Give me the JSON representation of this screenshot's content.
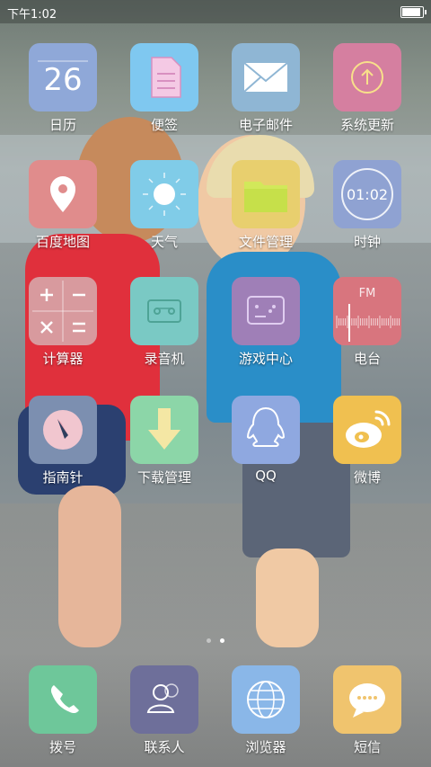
{
  "status_bar": {
    "time": "下午1:02",
    "battery_level": 0.9
  },
  "apps": {
    "calendar": {
      "label": "日历",
      "day": "26",
      "color": "#8fa8d8"
    },
    "notes": {
      "label": "便签",
      "color": "#7fc8f0"
    },
    "email": {
      "label": "电子邮件",
      "color": "#8fb6d4"
    },
    "update": {
      "label": "系统更新",
      "color": "#d57fa0"
    },
    "map": {
      "label": "百度地图",
      "color": "#e08c8c"
    },
    "weather": {
      "label": "天气",
      "color": "#80cce8"
    },
    "files": {
      "label": "文件管理",
      "color": "#e8cf6e"
    },
    "clock": {
      "label": "时钟",
      "clock_time": "01:02",
      "color": "#8fa2d2"
    },
    "calculator": {
      "label": "计算器",
      "color": "#d89a9e"
    },
    "recorder": {
      "label": "录音机",
      "color": "#7ac9c4"
    },
    "games": {
      "label": "游戏中心",
      "color": "#9f7fb7"
    },
    "radio": {
      "label": "电台",
      "fm_text": "FM",
      "color": "#d8757e"
    },
    "compass": {
      "label": "指南针",
      "color": "#7c8fb0"
    },
    "downloads": {
      "label": "下载管理",
      "color": "#8cd6a8"
    },
    "qq": {
      "label": "QQ",
      "color": "#8fa8e0"
    },
    "weibo": {
      "label": "微博",
      "color": "#f0c050"
    }
  },
  "dock": {
    "phone": {
      "label": "拨号",
      "color": "#6ec79a"
    },
    "contacts": {
      "label": "联系人",
      "color": "#6e6f9a"
    },
    "browser": {
      "label": "浏览器",
      "color": "#8ab7e8"
    },
    "sms": {
      "label": "短信",
      "color": "#f0c46e"
    }
  },
  "page_indicator": {
    "pages": 2,
    "current": 2
  }
}
